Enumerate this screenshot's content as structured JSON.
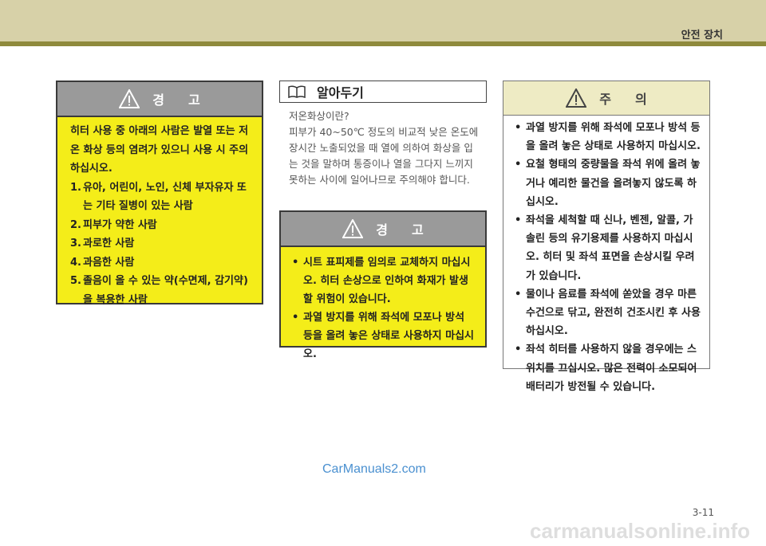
{
  "header": {
    "section": "안전 장치"
  },
  "warning_left": {
    "title_a": "경",
    "title_b": "고",
    "intro": "히터 사용 중 아래의 사람은 발열 또는 저온 화상 등의 염려가 있으니 사용 시 주의하십시오.",
    "items": [
      {
        "num": "1.",
        "text": "유아, 어린이, 노인, 신체 부자유자 또는 기타 질병이 있는 사람"
      },
      {
        "num": "2.",
        "text": "피부가 약한 사람"
      },
      {
        "num": "3.",
        "text": "과로한 사람"
      },
      {
        "num": "4.",
        "text": "과음한 사람"
      },
      {
        "num": "5.",
        "text": "졸음이 올 수 있는 약(수면제, 감기약)을 복용한 사람"
      }
    ]
  },
  "info": {
    "title": "알아두기",
    "question": "저온화상이란?",
    "text": "피부가 40~50℃ 정도의 비교적 낮은 온도에 장시간 노출되었을 때 열에 의하여 화상을 입는 것을 말하며 통증이나 열을 그다지 느끼지 못하는 사이에 일어나므로 주의해야 합니다."
  },
  "warning_center": {
    "title_a": "경",
    "title_b": "고",
    "bullets": [
      "시트 표피제를 임의로 교체하지 마십시오. 히터 손상으로 인하여 화재가 발생할 위험이 있습니다.",
      "과열 방지를 위해 좌석에 모포나 방석 등을 올려 놓은 상태로 사용하지 마십시오."
    ]
  },
  "caution": {
    "title_a": "주",
    "title_b": "의",
    "bullets": [
      "과열 방지를 위해 좌석에 모포나 방석 등을 올려 놓은 상태로 사용하지 마십시오.",
      "요철 형태의 중량물을 좌석 위에 올려 놓거나 예리한 물건을 올려놓지 않도록 하십시오.",
      "좌석을 세척할 때 신나, 벤젠, 알콜, 가솔린 등의 유기용제를 사용하지 마십시오. 히터 및 좌석 표면을 손상시킬 우려가 있습니다.",
      "물이나 음료를 좌석에 쏟았을 경우 마른 수건으로 닦고, 완전히 건조시킨 후 사용하십시오.",
      "좌석 히터를 사용하지 않을 경우에는 스위치를 끄십시오. 많은 전력이 소모되어 배터리가 방전될 수 있습니다."
    ]
  },
  "watermark": "CarManuals2.com",
  "page_number": "3-11",
  "footer_watermark": "carmanualsonline.info",
  "colors": {
    "band": "#d7d1a8",
    "band_line": "#8f8a3c",
    "warning_fill": "#f4ed19",
    "caution_head": "#eeebc4"
  }
}
